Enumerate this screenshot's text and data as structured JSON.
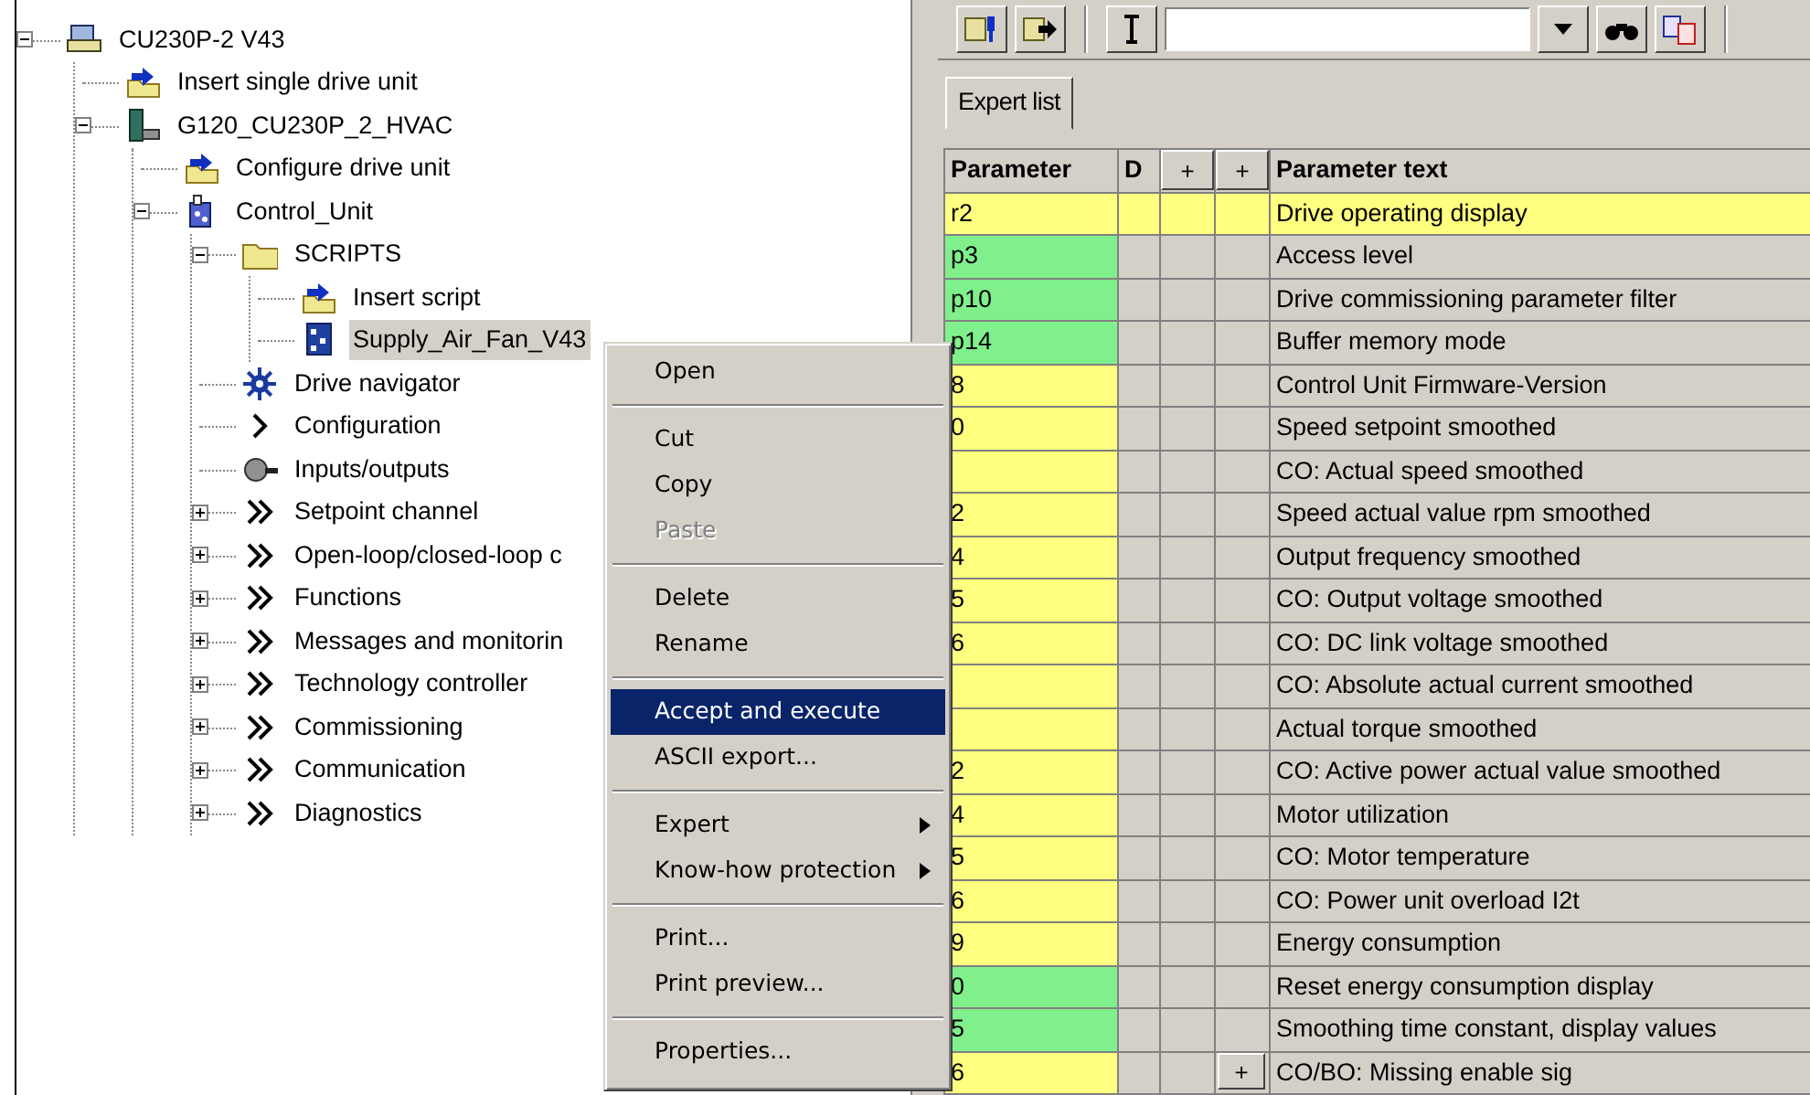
{
  "tree": [
    {
      "label": "CU230P-2 V43",
      "kind": "device",
      "expanded": true,
      "children": [
        {
          "label": "Insert single drive unit",
          "kind": "insert"
        },
        {
          "label": "G120_CU230P_2_HVAC",
          "kind": "drive",
          "expanded": true,
          "children": [
            {
              "label": "Configure drive unit",
              "kind": "insert"
            },
            {
              "label": "Control_Unit",
              "kind": "unit",
              "expanded": true,
              "children": [
                {
                  "label": "SCRIPTS",
                  "kind": "folder",
                  "expanded": true,
                  "children": [
                    {
                      "label": "Insert script",
                      "kind": "insert",
                      "selected": false
                    },
                    {
                      "label": "Supply_Air_Fan_V43",
                      "kind": "script",
                      "selected": true
                    }
                  ]
                },
                {
                  "label": "Drive navigator",
                  "kind": "navigator"
                },
                {
                  "label": "Configuration",
                  "kind": "single"
                },
                {
                  "label": "Inputs/outputs",
                  "kind": "io"
                },
                {
                  "label": "Setpoint channel",
                  "kind": "double",
                  "expanded": false
                },
                {
                  "label": "Open-loop/closed-loop c",
                  "kind": "double",
                  "expanded": false
                },
                {
                  "label": "Functions",
                  "kind": "double",
                  "expanded": false
                },
                {
                  "label": "Messages and monitorin",
                  "kind": "double",
                  "expanded": false
                },
                {
                  "label": "Technology controller",
                  "kind": "double",
                  "expanded": false
                },
                {
                  "label": "Commissioning",
                  "kind": "double",
                  "expanded": false
                },
                {
                  "label": "Communication",
                  "kind": "double",
                  "expanded": false
                },
                {
                  "label": "Diagnostics",
                  "kind": "double",
                  "expanded": false
                }
              ]
            }
          ]
        }
      ]
    }
  ],
  "tabs": [
    {
      "label": "Expert list",
      "selected": true
    }
  ],
  "table": {
    "columns": [
      {
        "label": "Parameter",
        "kind": "text"
      },
      {
        "label": "D",
        "kind": "text"
      },
      {
        "label": "+",
        "kind": "button"
      },
      {
        "label": "+",
        "kind": "button"
      },
      {
        "label": "Parameter text",
        "kind": "text"
      }
    ],
    "rows": [
      {
        "parameter": "r2",
        "color": "#ffff80",
        "text": "Drive operating display",
        "selected": true
      },
      {
        "parameter": "p3",
        "color": "#80f08c",
        "text": "Access level",
        "selected": false
      },
      {
        "parameter": "p10",
        "color": "#80f08c",
        "text": "Drive commissioning parameter filter",
        "selected": false
      },
      {
        "parameter": "p14",
        "color": "#80f08c",
        "text": "Buffer memory mode",
        "selected": false
      },
      {
        "parameter": "8",
        "color": "#ffff80",
        "text": "Control Unit Firmware-Version",
        "selected": false
      },
      {
        "parameter": "0",
        "color": "#ffff80",
        "text": "Speed setpoint smoothed",
        "selected": false
      },
      {
        "color": "#ffff80",
        "text": "CO: Actual speed smoothed",
        "selected": false
      },
      {
        "parameter": "2",
        "color": "#ffff80",
        "text": "Speed actual value rpm smoothed",
        "selected": false
      },
      {
        "parameter": "4",
        "color": "#ffff80",
        "text": "Output frequency smoothed",
        "selected": false
      },
      {
        "parameter": "5",
        "color": "#ffff80",
        "text": "CO: Output voltage smoothed",
        "selected": false
      },
      {
        "parameter": "6",
        "color": "#ffff80",
        "text": "CO: DC link voltage smoothed",
        "selected": false
      },
      {
        "color": "#ffff80",
        "text": "CO: Absolute actual current smoothed",
        "selected": false
      },
      {
        "color": "#ffff80",
        "text": "Actual torque smoothed",
        "selected": false
      },
      {
        "parameter": "2",
        "color": "#ffff80",
        "text": "CO: Active power actual value smoothed",
        "selected": false
      },
      {
        "parameter": "4",
        "color": "#ffff80",
        "text": "Motor utilization",
        "selected": false
      },
      {
        "parameter": "5",
        "color": "#ffff80",
        "text": "CO: Motor temperature",
        "selected": false
      },
      {
        "parameter": "6",
        "color": "#ffff80",
        "text": "CO: Power unit overload I2t",
        "selected": false
      },
      {
        "parameter": "9",
        "color": "#ffff80",
        "text": "Energy consumption",
        "selected": false
      },
      {
        "parameter": "0",
        "color": "#80f08c",
        "text": "Reset energy consumption display",
        "selected": false
      },
      {
        "parameter": "5",
        "color": "#80f08c",
        "text": "Smoothing time constant, display values",
        "selected": false
      },
      {
        "parameter": "6",
        "color": "#ffff80",
        "text": "CO/BO: Missing enable sig",
        "selected": false,
        "expand_button": "+"
      }
    ]
  },
  "context_menu": {
    "groups": [
      [
        {
          "label": "Open",
          "disabled": false,
          "selected": false,
          "submenu": false
        }
      ],
      [
        {
          "label": "Cut",
          "disabled": false,
          "selected": false,
          "submenu": false
        },
        {
          "label": "Copy",
          "disabled": false,
          "selected": false,
          "submenu": false
        },
        {
          "label": "Paste",
          "disabled": true,
          "selected": false,
          "submenu": false
        }
      ],
      [
        {
          "label": "Delete",
          "disabled": false,
          "selected": false,
          "submenu": false
        },
        {
          "label": "Rename",
          "disabled": false,
          "selected": false,
          "submenu": false
        }
      ],
      [
        {
          "label": "Accept and execute",
          "disabled": false,
          "selected": true,
          "submenu": false
        },
        {
          "label": "ASCII export...",
          "disabled": false,
          "selected": false,
          "submenu": false
        }
      ],
      [
        {
          "label": "Expert",
          "disabled": false,
          "selected": false,
          "submenu": true
        },
        {
          "label": "Know-how protection",
          "disabled": false,
          "selected": false,
          "submenu": true
        }
      ],
      [
        {
          "label": "Print...",
          "disabled": false,
          "selected": false,
          "submenu": false
        },
        {
          "label": "Print preview...",
          "disabled": false,
          "selected": false,
          "submenu": false
        }
      ],
      [
        {
          "label": "Properties...",
          "disabled": false,
          "selected": false,
          "submenu": false
        }
      ]
    ]
  }
}
